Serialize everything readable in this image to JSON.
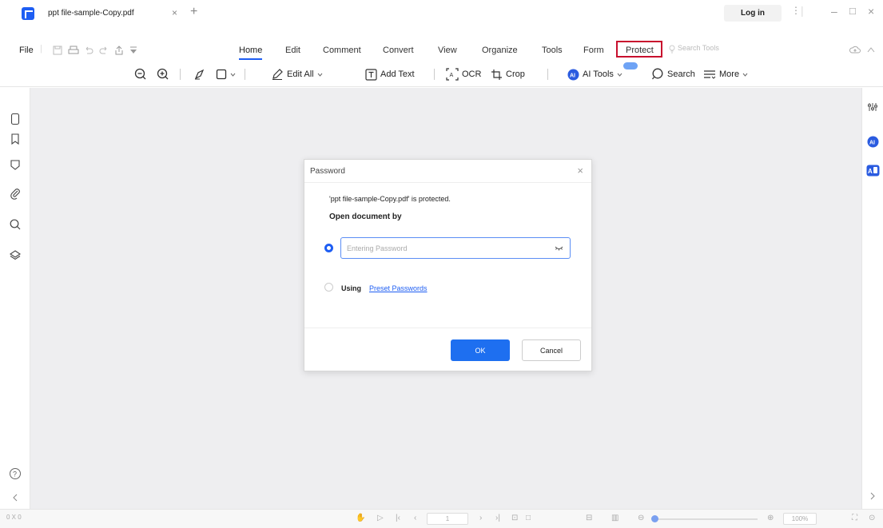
{
  "titlebar": {
    "tab_title": "ppt file-sample-Copy.pdf",
    "tab_close": "×",
    "tab_add": "+",
    "login_label": "Log in"
  },
  "menubar": {
    "file_label": "File",
    "tabs": [
      "Home",
      "Edit",
      "Comment",
      "Convert",
      "View",
      "Organize",
      "Tools",
      "Form",
      "Protect"
    ],
    "active_tab": "Home",
    "highlighted_tab": "Protect",
    "search_placeholder": "Search Tools"
  },
  "toolbar": {
    "edit_all": "Edit All",
    "add_text": "Add Text",
    "ocr": "OCR",
    "crop": "Crop",
    "ai_tools": "AI Tools",
    "search": "Search",
    "more": "More"
  },
  "dialog": {
    "title": "Password",
    "message": "'ppt file-sample-Copy.pdf' is protected.",
    "open_by": "Open document by",
    "password_placeholder": "Entering Password",
    "using_label": "Using",
    "preset_link": "Preset Passwords",
    "ok_label": "OK",
    "cancel_label": "Cancel"
  },
  "status": {
    "coords": "0 X 0",
    "page": "1",
    "zoom": "100%"
  },
  "colors": {
    "accent": "#1e5ef3",
    "protect_highlight": "#c8102e",
    "canvas_bg": "#eeeef0"
  }
}
